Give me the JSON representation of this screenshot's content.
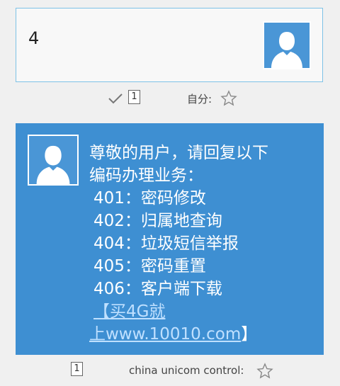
{
  "sent": {
    "message": "4",
    "receipt_count": "1",
    "sender_label": "自分:"
  },
  "received": {
    "line1": "尊敬的用户，请回复以下",
    "line2": "编码办理业务：",
    "items": [
      "401：密码修改",
      "402：归属地查询",
      "404：垃圾短信举报",
      "405：密码重置",
      "406：客户端下载"
    ],
    "link_line1": "【买4G就",
    "link_line2_prefix": "上",
    "link_url": "www.10010.com",
    "link_suffix": "】",
    "count": "1",
    "sender_label": "china unicom control:"
  },
  "colors": {
    "page_bg": "#f0f0f0",
    "incoming_bubble": "#3e8fd2",
    "avatar_bg": "#4a96d6",
    "outgoing_border": "#7ec2e6"
  },
  "icons": [
    "avatar-icon",
    "check-icon",
    "star-icon"
  ]
}
